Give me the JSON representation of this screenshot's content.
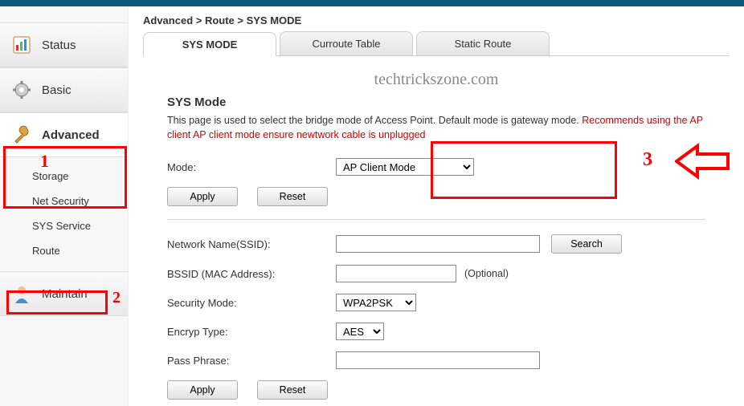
{
  "sidebar": {
    "items": [
      {
        "label": "Status"
      },
      {
        "label": "Basic"
      },
      {
        "label": "Advanced",
        "selected": true,
        "sub": [
          {
            "label": "Storage"
          },
          {
            "label": "Net Security"
          },
          {
            "label": "SYS Service"
          },
          {
            "label": "Route",
            "active": true
          }
        ]
      },
      {
        "label": "Maintain"
      }
    ]
  },
  "breadcrumb": "Advanced > Route > SYS MODE",
  "tabs": [
    {
      "label": "SYS MODE",
      "active": true
    },
    {
      "label": "Curroute Table"
    },
    {
      "label": "Static Route"
    }
  ],
  "watermark": "techtrickszone.com",
  "section": {
    "title": "SYS Mode",
    "desc_black": "This page is used to select the bridge mode of Access Point. Default mode is gateway mode. ",
    "desc_red": "Recommends using the AP client AP client mode ensure newtwork cable is unplugged"
  },
  "form": {
    "mode_label": "Mode:",
    "mode_value": "AP Client Mode",
    "apply": "Apply",
    "reset": "Reset",
    "ssid_label": "Network Name(SSID):",
    "ssid_value": "",
    "search": "Search",
    "bssid_label": "BSSID (MAC Address):",
    "bssid_value": "",
    "bssid_note": "(Optional)",
    "sec_label": "Security Mode:",
    "sec_value": "WPA2PSK",
    "enc_label": "Encryp Type:",
    "enc_value": "AES",
    "pp_label": "Pass Phrase:",
    "pp_value": ""
  },
  "anno": {
    "n1": "1",
    "n2": "2",
    "n3": "3"
  }
}
